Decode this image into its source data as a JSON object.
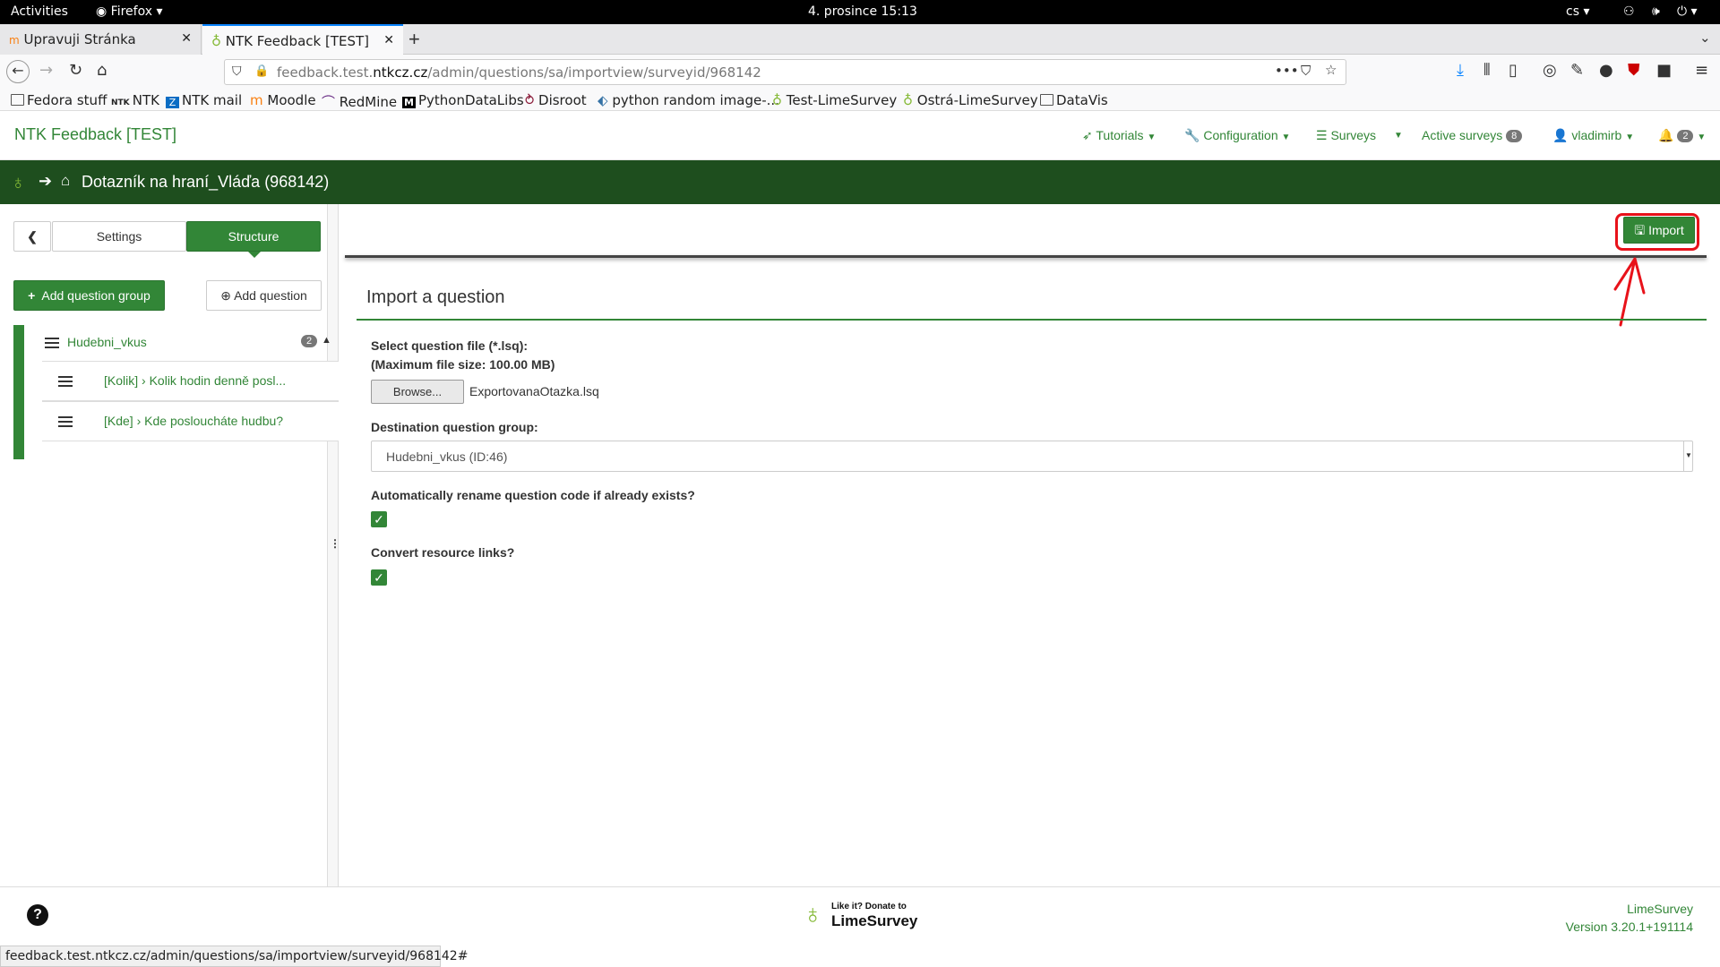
{
  "gnome": {
    "activities": "Activities",
    "app": "Firefox",
    "clock": "4. prosince  15:13",
    "lang": "cs"
  },
  "tabs": [
    {
      "title": "Upravuji Stránka"
    },
    {
      "title": "NTK Feedback [TEST]"
    }
  ],
  "url": {
    "prefix": "feedback.test.",
    "host": "ntkcz.cz",
    "path": "/admin/questions/sa/importview/surveyid/968142"
  },
  "bookmarks": [
    "Fedora stuff",
    "NTK",
    "NTK mail",
    "Moodle",
    "RedMine",
    "PythonDataLibs",
    "Disroot",
    "python random image-...",
    "Test-LimeSurvey",
    "Ostrá-LimeSurvey",
    "DataVis"
  ],
  "header": {
    "brand": "NTK Feedback [TEST]",
    "tutorials": "Tutorials",
    "configuration": "Configuration",
    "surveys": "Surveys",
    "active_surveys": "Active surveys",
    "active_count": "8",
    "user": "vladimirb",
    "notif_count": "2"
  },
  "survey": {
    "title": "Dotazník na hraní_Vláďa (968142)"
  },
  "sidebar": {
    "settings_tab": "Settings",
    "structure_tab": "Structure",
    "add_group": "Add question group",
    "add_question": "Add question",
    "group_name": "Hudebni_vkus",
    "group_count": "2",
    "questions": [
      {
        "code": "[Kolik]",
        "text": "Kolik hodin denně posl..."
      },
      {
        "code": "[Kde]",
        "text": "Kde posloucháte hudbu?"
      }
    ]
  },
  "toolbar": {
    "import_label": "Import"
  },
  "form": {
    "title": "Import a question",
    "file_label": "Select question file (*.lsq):",
    "max_size": "(Maximum file size: 100.00 MB)",
    "browse": "Browse...",
    "file_name": "ExportovanaOtazka.lsq",
    "dest_label": "Destination question group:",
    "dest_value": "Hudebni_vkus (ID:46)",
    "rename_label": "Automatically rename question code if already exists?",
    "convert_label": "Convert resource links?"
  },
  "footer": {
    "donate_small": "Like it? Donate to",
    "donate_brand": "LimeSurvey",
    "product": "LimeSurvey",
    "version": "Version 3.20.1+191114"
  },
  "status_url": "feedback.test.ntkcz.cz/admin/questions/sa/importview/surveyid/968142#",
  "colors": {
    "accent": "#328637",
    "dark_bar": "#1e4e1e",
    "annotation": "#e8121a"
  }
}
